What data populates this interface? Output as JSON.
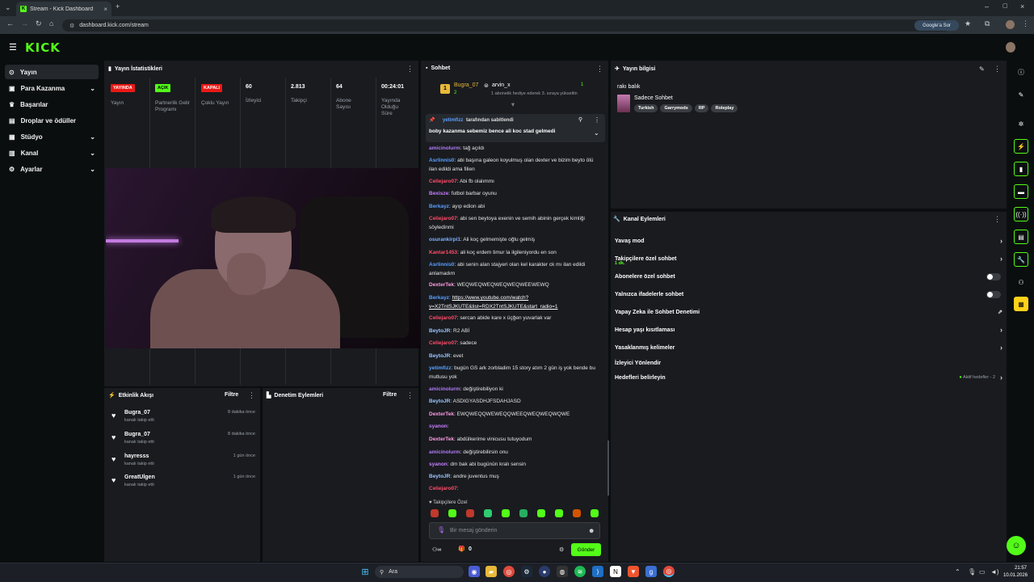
{
  "browser": {
    "tab_title": "Stream - Kick Dashboard",
    "url": "dashboard.kick.com/stream",
    "google_sor": "Google'a Sor"
  },
  "brand": {
    "logo": "KICK",
    "accent": "#53fc18"
  },
  "sidebar": {
    "items": [
      {
        "label": "Yayın"
      },
      {
        "label": "Para Kazanma"
      },
      {
        "label": "Başarılar"
      },
      {
        "label": "Droplar ve ödüller"
      },
      {
        "label": "Stüdyo"
      },
      {
        "label": "Kanal"
      },
      {
        "label": "Ayarlar"
      }
    ]
  },
  "stats": {
    "title": "Yayın İstatistikleri",
    "items": [
      {
        "badge": "YAYINDA",
        "label": "Yayın"
      },
      {
        "badge": "AÇIK",
        "label": "Partnerlik Gelir Programı"
      },
      {
        "badge": "KAPALI",
        "label": "Çoklu Yayın"
      },
      {
        "value": "60",
        "label": "İzleyici"
      },
      {
        "value": "2.813",
        "label": "Takipçi"
      },
      {
        "value": "64",
        "label": "Abone Sayısı"
      },
      {
        "value": "00:24:01",
        "label": "Yayında Olduğu Süre"
      }
    ]
  },
  "activity": {
    "title": "Etkinlik Akışı",
    "filter": "Filtre",
    "items": [
      {
        "name": "Bugra_07",
        "sub": "kanalı takip etti",
        "time": "8 dakika önce"
      },
      {
        "name": "Bugra_07",
        "sub": "kanalı takip etti",
        "time": "8 dakika önce"
      },
      {
        "name": "hayresss",
        "sub": "kanalı takip etti",
        "time": "1 gün önce"
      },
      {
        "name": "GreatUlgen",
        "sub": "kanalı takip etti",
        "time": "1 gün önce"
      }
    ]
  },
  "moderation": {
    "title": "Denetim Eylemleri",
    "filter": "Filtre"
  },
  "chat": {
    "title": "Sohbet",
    "gift": {
      "user": "Bugra_07",
      "count": "2",
      "target": "arvin_x",
      "rank": "1",
      "note": "1 abonelik hediye ederek 3. sıraya yükseltin"
    },
    "pinned": {
      "by": "yetimfizz",
      "suffix": "tarafından sabitlendi",
      "text": "boby kazanma sebemiz bence ali koc stad gelmedi"
    },
    "messages": [
      {
        "user": "amicinolurm",
        "color": "#b07cf5",
        "text": "tağ açıldı"
      },
      {
        "user": "Asrlinnis0",
        "color": "#5aa0ff",
        "text": "abi başına galeon koyulmuş olan dexter ve bizim beyto ölü ilan edildi ama filien"
      },
      {
        "user": "Celiejaro07",
        "color": "#ff4d6a",
        "text": "Abi fb olalımmı"
      },
      {
        "user": "Bexisze",
        "color": "#c77dff",
        "text": "futbol barbar oyunu"
      },
      {
        "user": "Berkayz",
        "color": "#5aa0ff",
        "text": "ayıp edion abi"
      },
      {
        "user": "Celiejaro07",
        "color": "#ff4d6a",
        "text": "abi sen beytoya exenin ve semih abinin gerçek kimliği söyledinmi"
      },
      {
        "user": "osurankirpi1",
        "color": "#7fb2ff",
        "text": "Ali koç gelmemişte oğlu gelmiş"
      },
      {
        "user": "Kantar1453",
        "color": "#ff4d6a",
        "text": "ali koç erdem timur la ilgileniyordu en son"
      },
      {
        "user": "Asrlinnis0",
        "color": "#5aa0ff",
        "text": "abi senin alan stajyeri olan kel karakter ck mı ilan edildi anlamadım"
      },
      {
        "user": "DexterTek",
        "color": "#ff9be3",
        "text": "WEQWEQWEQWEQWEQWEEWEWQ"
      },
      {
        "user": "Berkayz",
        "color": "#5aa0ff",
        "text": "https://www.youtube.com/watch?v=X2TntSJKUTE&list=RDX2TntSJKUTE&start_radio=1"
      },
      {
        "user": "Celiejaro07",
        "color": "#ff4d6a",
        "text": "sercan abide kare x üçğen yuvarlak var"
      },
      {
        "user": "BeytoJR",
        "color": "#9cc7ff",
        "text": "R2 ABİ"
      },
      {
        "user": "Celiejaro07",
        "color": "#ff4d6a",
        "text": "sadece"
      },
      {
        "user": "BeytoJR",
        "color": "#9cc7ff",
        "text": "evet"
      },
      {
        "user": "yetimfizz",
        "color": "#5aa0ff",
        "text": "bugün GS ark zorbladim 15 story atım 2 gün iş yok bende bu mutlusu yok"
      },
      {
        "user": "amicinolurm",
        "color": "#b07cf5",
        "text": "değiştirebiliyon ki"
      },
      {
        "user": "BeytoJR",
        "color": "#9cc7ff",
        "text": "ASDIGYASDHJFSDAHJASD"
      },
      {
        "user": "DexterTek",
        "color": "#ff9be3",
        "text": "EWQWEQQWEWEQQWEEQWEQWEQWQWE"
      },
      {
        "user": "syanon",
        "color": "#c77dff",
        "text": ""
      },
      {
        "user": "DexterTek",
        "color": "#ff9be3",
        "text": "abdülkerime vinicusu tutuyodum"
      },
      {
        "user": "amicinolurm",
        "color": "#b07cf5",
        "text": "değiştirebilirsin onu"
      },
      {
        "user": "syanon",
        "color": "#c77dff",
        "text": "dm bak abi bugünün kralı sensin"
      },
      {
        "user": "BeytoJR",
        "color": "#9cc7ff",
        "text": "andre juventus muş"
      },
      {
        "user": "Celiejaro07",
        "color": "#ff4d6a",
        "text": ""
      }
    ],
    "followers_only": "Takipçilere Özel",
    "placeholder": "Bir mesaj gönderin",
    "count": "0",
    "send": "Gönder"
  },
  "streaminfo": {
    "title": "Yayın bilgisi",
    "stream_title": "rakı balık",
    "category": "Sadece Sohbet",
    "tags": [
      "Turkish",
      "Garrymods",
      "RP",
      "Roleplay"
    ]
  },
  "channel": {
    "title": "Kanal Eylemleri",
    "rows": [
      {
        "label": "Yavaş mod",
        "kind": "arrow"
      },
      {
        "label": "Takipçilere özel sohbet",
        "sub": "1 dk.",
        "kind": "arrow"
      },
      {
        "label": "Abonelere özel sohbet",
        "kind": "toggle"
      },
      {
        "label": "Yalnızca ifadelerle sohbet",
        "kind": "toggle"
      },
      {
        "label": "Yapay Zeka ile Sohbet Denetimi",
        "kind": "ext"
      },
      {
        "label": "Hesap yaşı kısıtlaması",
        "kind": "arrow"
      },
      {
        "label": "Yasaklanmış kelimeler",
        "kind": "arrow"
      },
      {
        "label": "İzleyici Yönlendir",
        "kind": "none"
      },
      {
        "label": "Hedefleri belirleyin",
        "kind": "goal",
        "right": "Aktif hedefler - 2"
      }
    ]
  },
  "taskbar": {
    "search": "Ara",
    "time": "21:57",
    "date": "10.01.2026"
  }
}
